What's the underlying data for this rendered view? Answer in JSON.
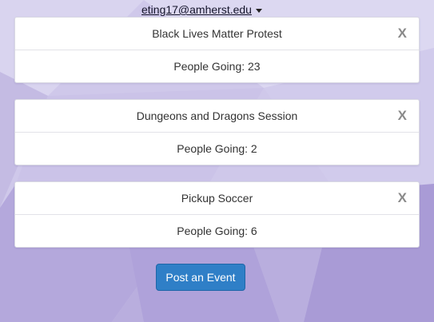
{
  "header": {
    "account_email": "eting17@amherst.edu"
  },
  "events": [
    {
      "title": "Black Lives Matter Protest",
      "going_label": "People Going: 23",
      "close_label": "X"
    },
    {
      "title": "Dungeons and Dragons Session",
      "going_label": "People Going: 2",
      "close_label": "X"
    },
    {
      "title": "Pickup Soccer",
      "going_label": "People Going: 6",
      "close_label": "X"
    }
  ],
  "actions": {
    "post_event_label": "Post an Event"
  },
  "colors": {
    "background": "#c9c0e6",
    "button": "#2f7fc7",
    "card": "#ffffff"
  },
  "icons": {
    "account_caret": "caret-down-icon"
  }
}
